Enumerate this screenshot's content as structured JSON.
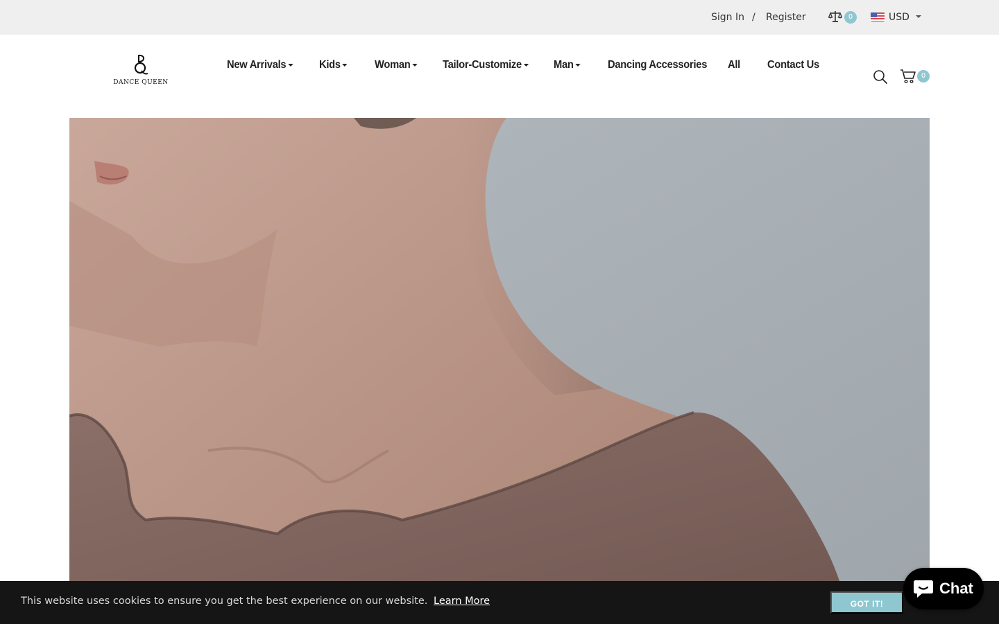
{
  "topbar": {
    "sign_in": "Sign In",
    "separator": "/",
    "register": "Register",
    "compare_count": "0",
    "currency": "USD",
    "compare_icon": "scale-icon",
    "flag_icon": "us-flag-icon"
  },
  "header": {
    "logo_text": "DANCE QUEEN",
    "nav": [
      {
        "label": "New Arrivals",
        "has_dropdown": true
      },
      {
        "label": "Kids",
        "has_dropdown": true
      },
      {
        "label": "Woman",
        "has_dropdown": true
      },
      {
        "label": "Tailor-Customize",
        "has_dropdown": true
      },
      {
        "label": "Man",
        "has_dropdown": true
      },
      {
        "label": "Dancing Accessories",
        "has_dropdown": false
      },
      {
        "label": "All",
        "has_dropdown": false
      },
      {
        "label": "Contact Us",
        "has_dropdown": false
      }
    ],
    "cart_count": "0",
    "search_icon": "search-icon",
    "cart_icon": "cart-icon"
  },
  "cookie_bar": {
    "message": "This website uses cookies to ensure you get the best experience on our website.",
    "link": "Learn More",
    "button": "GOT IT!"
  },
  "chat": {
    "label": "Chat",
    "icon": "chat-bubble-icon"
  },
  "colors": {
    "accent": "#8fc7d1",
    "topbar_bg": "#efefef",
    "cookie_bg": "#151515",
    "chat_bg": "#000000"
  }
}
